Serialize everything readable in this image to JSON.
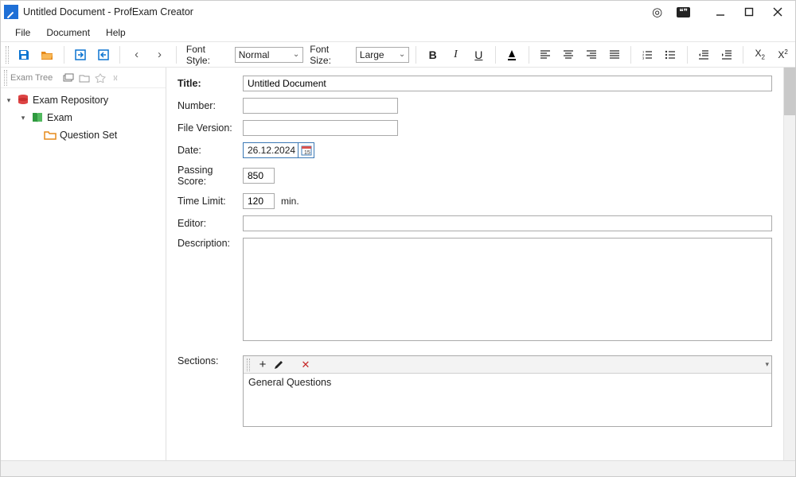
{
  "titlebar": {
    "doc": "Untitled Document",
    "app": "ProfExam Creator",
    "sep": " - "
  },
  "menu": {
    "file": "File",
    "document": "Document",
    "help": "Help"
  },
  "toolbar": {
    "font_style_label": "Font Style:",
    "font_style_value": "Normal",
    "font_size_label": "Font Size:",
    "font_size_value": "Large"
  },
  "sidebar": {
    "heading": "Exam Tree",
    "root": "Exam Repository",
    "exam": "Exam",
    "qset": "Question Set"
  },
  "form": {
    "title_label": "Title:",
    "title_value": "Untitled Document",
    "number_label": "Number:",
    "number_value": "",
    "filever_label": "File Version:",
    "filever_value": "",
    "date_label": "Date:",
    "date_value": "26.12.2024",
    "cal_badge": "15",
    "pass_label": "Passing Score:",
    "pass_value": "850",
    "time_label": "Time Limit:",
    "time_value": "120",
    "time_unit": "min.",
    "editor_label": "Editor:",
    "editor_value": "",
    "desc_label": "Description:",
    "sections_label": "Sections:",
    "sections_item0": "General Questions"
  }
}
